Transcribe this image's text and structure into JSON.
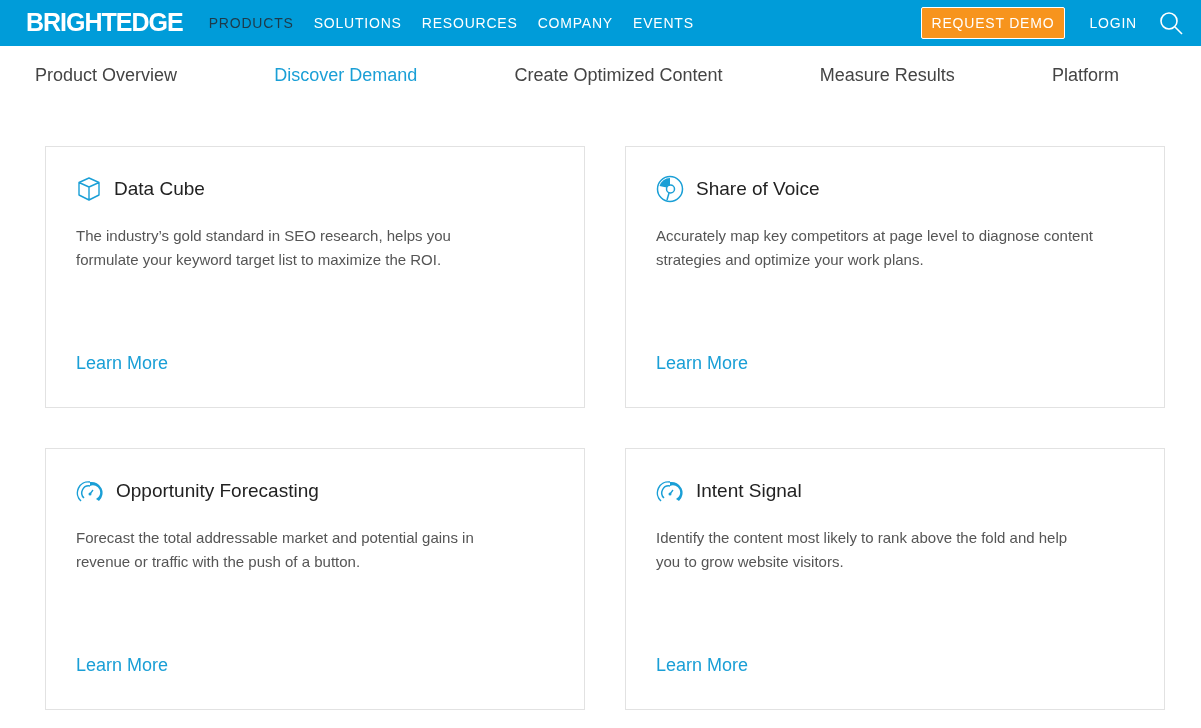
{
  "header": {
    "logo": "BRIGHTEDGE",
    "nav": [
      {
        "label": "PRODUCTS",
        "selected": true
      },
      {
        "label": "SOLUTIONS",
        "selected": false
      },
      {
        "label": "RESOURCES",
        "selected": false
      },
      {
        "label": "COMPANY",
        "selected": false
      },
      {
        "label": "EVENTS",
        "selected": false
      }
    ],
    "cta": "REQUEST DEMO",
    "login": "LOGIN"
  },
  "subnav": [
    {
      "label": "Product Overview",
      "selected": false
    },
    {
      "label": "Discover Demand",
      "selected": true
    },
    {
      "label": "Create Optimized Content",
      "selected": false
    },
    {
      "label": "Measure Results",
      "selected": false
    },
    {
      "label": "Platform",
      "selected": false
    }
  ],
  "cards": [
    {
      "kind": "cube",
      "title": "Data Cube",
      "description": "The industry’s gold standard in SEO research, helps you formulate your keyword target list to maximize the ROI.",
      "link": "Learn More"
    },
    {
      "kind": "pie",
      "title": "Share of Voice",
      "description": "Accurately map key competitors at page level to diagnose content strategies and optimize your work plans.",
      "link": "Learn More"
    },
    {
      "kind": "gauge",
      "title": "Opportunity Forecasting",
      "description": "Forecast the total addressable market and potential gains in revenue or traffic with the push of a button.",
      "link": "Learn More"
    },
    {
      "kind": "gauge",
      "title": "Intent Signal",
      "description": "Identify the content most likely to rank above the fold and help you to grow website visitors.",
      "link": "Learn More"
    }
  ]
}
